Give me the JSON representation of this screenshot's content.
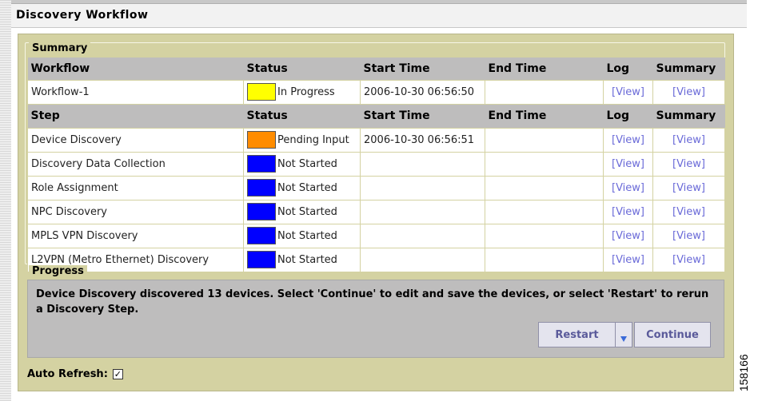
{
  "page": {
    "title": "Discovery Workflow"
  },
  "summary_legend": "Summary",
  "workflow_headers": {
    "name": "Workflow",
    "status": "Status",
    "start": "Start Time",
    "end": "End Time",
    "log": "Log",
    "summary": "Summary"
  },
  "workflow_row": {
    "name": "Workflow-1",
    "status": "In Progress",
    "status_color": "#ffff00",
    "start": "2006-10-30 06:56:50",
    "end": "",
    "log": "[View]",
    "summary": "[View]"
  },
  "step_headers": {
    "name": "Step",
    "status": "Status",
    "start": "Start Time",
    "end": "End Time",
    "log": "Log",
    "summary": "Summary"
  },
  "steps": [
    {
      "name": "Device Discovery",
      "status": "Pending Input",
      "status_color": "#ff8c00",
      "start": "2006-10-30 06:56:51",
      "end": "",
      "log": "[View]",
      "summary": "[View]"
    },
    {
      "name": "Discovery Data Collection",
      "status": "Not Started",
      "status_color": "#0000ff",
      "start": "",
      "end": "",
      "log": "[View]",
      "summary": "[View]"
    },
    {
      "name": "Role Assignment",
      "status": "Not Started",
      "status_color": "#0000ff",
      "start": "",
      "end": "",
      "log": "[View]",
      "summary": "[View]"
    },
    {
      "name": "NPC Discovery",
      "status": "Not Started",
      "status_color": "#0000ff",
      "start": "",
      "end": "",
      "log": "[View]",
      "summary": "[View]"
    },
    {
      "name": "MPLS VPN Discovery",
      "status": "Not Started",
      "status_color": "#0000ff",
      "start": "",
      "end": "",
      "log": "[View]",
      "summary": "[View]"
    },
    {
      "name": "L2VPN (Metro Ethernet) Discovery",
      "status": "Not Started",
      "status_color": "#0000ff",
      "start": "",
      "end": "",
      "log": "[View]",
      "summary": "[View]"
    }
  ],
  "progress": {
    "legend": "Progress",
    "message": "Device Discovery discovered 13 devices. Select 'Continue' to edit and save the devices, or select 'Restart' to rerun a Discovery Step.",
    "restart_label": "Restart",
    "continue_label": "Continue"
  },
  "auto_refresh": {
    "label": "Auto Refresh:",
    "checked": true,
    "check_glyph": "✓"
  },
  "figure_number": "158166"
}
